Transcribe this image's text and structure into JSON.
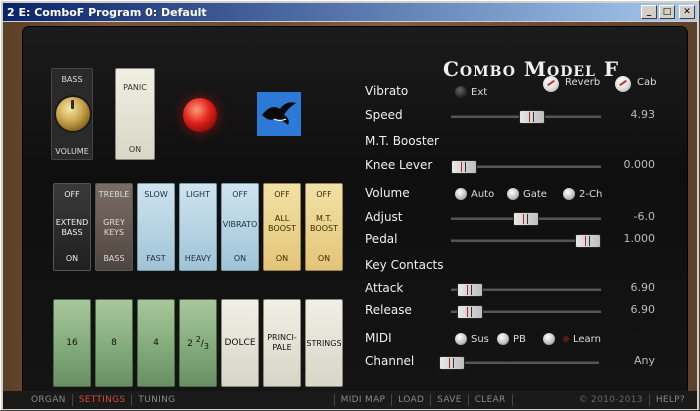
{
  "window": {
    "title": "2 E: ComboF Program 0: Default",
    "min": "_",
    "max": "□",
    "close": "✕"
  },
  "panel": {
    "title": "Combo Model F"
  },
  "bass": {
    "top": "BASS",
    "bottom": "VOLUME"
  },
  "panic": {
    "top": "PANIC",
    "bottom": "ON"
  },
  "tabs": [
    {
      "top": "OFF",
      "mid": "EXTEND BASS",
      "bottom": "ON",
      "style": "dark"
    },
    {
      "top": "TREBLE",
      "mid": "GREY KEYS",
      "bottom": "BASS",
      "style": "grey"
    },
    {
      "top": "SLOW",
      "mid": "",
      "bottom": "FAST",
      "style": "blue"
    },
    {
      "top": "LIGHT",
      "mid": "",
      "bottom": "HEAVY",
      "style": "blue"
    },
    {
      "top": "OFF",
      "mid": "VIBRATO",
      "bottom": "ON",
      "style": "blue"
    },
    {
      "top": "OFF",
      "mid": "ALL BOOST",
      "bottom": "ON",
      "style": "yellow"
    },
    {
      "top": "OFF",
      "mid": "M.T. BOOST",
      "bottom": "ON",
      "style": "yellow"
    }
  ],
  "drawbars": [
    {
      "label": "16",
      "style": "green"
    },
    {
      "label": "8",
      "style": "green"
    },
    {
      "label": "4",
      "style": "green"
    },
    {
      "label": "2",
      "num": "2",
      "den": "3",
      "style": "green"
    },
    {
      "label": "DOLCE",
      "style": "white"
    },
    {
      "label": "PRINCI-PALE",
      "style": "white"
    },
    {
      "label": "STRINGS",
      "style": "white"
    }
  ],
  "vibrato": {
    "label": "Vibrato",
    "ext": "Ext",
    "reverb": "Reverb",
    "cab": "Cab"
  },
  "speed": {
    "label": "Speed",
    "value": "4.93",
    "pos": 0.55
  },
  "booster": {
    "section": "M.T. Booster",
    "knee_label": "Knee Lever",
    "knee_value": "0.000",
    "knee_pos": 0.0
  },
  "volume": {
    "label": "Volume",
    "auto": "Auto",
    "gate": "Gate",
    "twoch": "2-Ch"
  },
  "adjust": {
    "label": "Adjust",
    "value": "-6.0",
    "pos": 0.5
  },
  "pedal": {
    "label": "Pedal",
    "value": "1.000",
    "pos": 1.0
  },
  "keycontacts": {
    "section": "Key Contacts",
    "attack_label": "Attack",
    "attack_value": "6.90",
    "attack_pos": 0.05,
    "release_label": "Release",
    "release_value": "6.90",
    "release_pos": 0.05
  },
  "midi": {
    "label": "MIDI",
    "sus": "Sus",
    "pb": "PB",
    "learn": "Learn",
    "channel_label": "Channel",
    "channel_value": "Any"
  },
  "bottom": {
    "organ": "ORGAN",
    "settings": "SETTINGS",
    "tuning": "TUNING",
    "midimap": "MIDI MAP",
    "load": "LOAD",
    "save": "SAVE",
    "clear": "CLEAR",
    "copyright": "© 2010-2013",
    "help": "HELP?"
  }
}
